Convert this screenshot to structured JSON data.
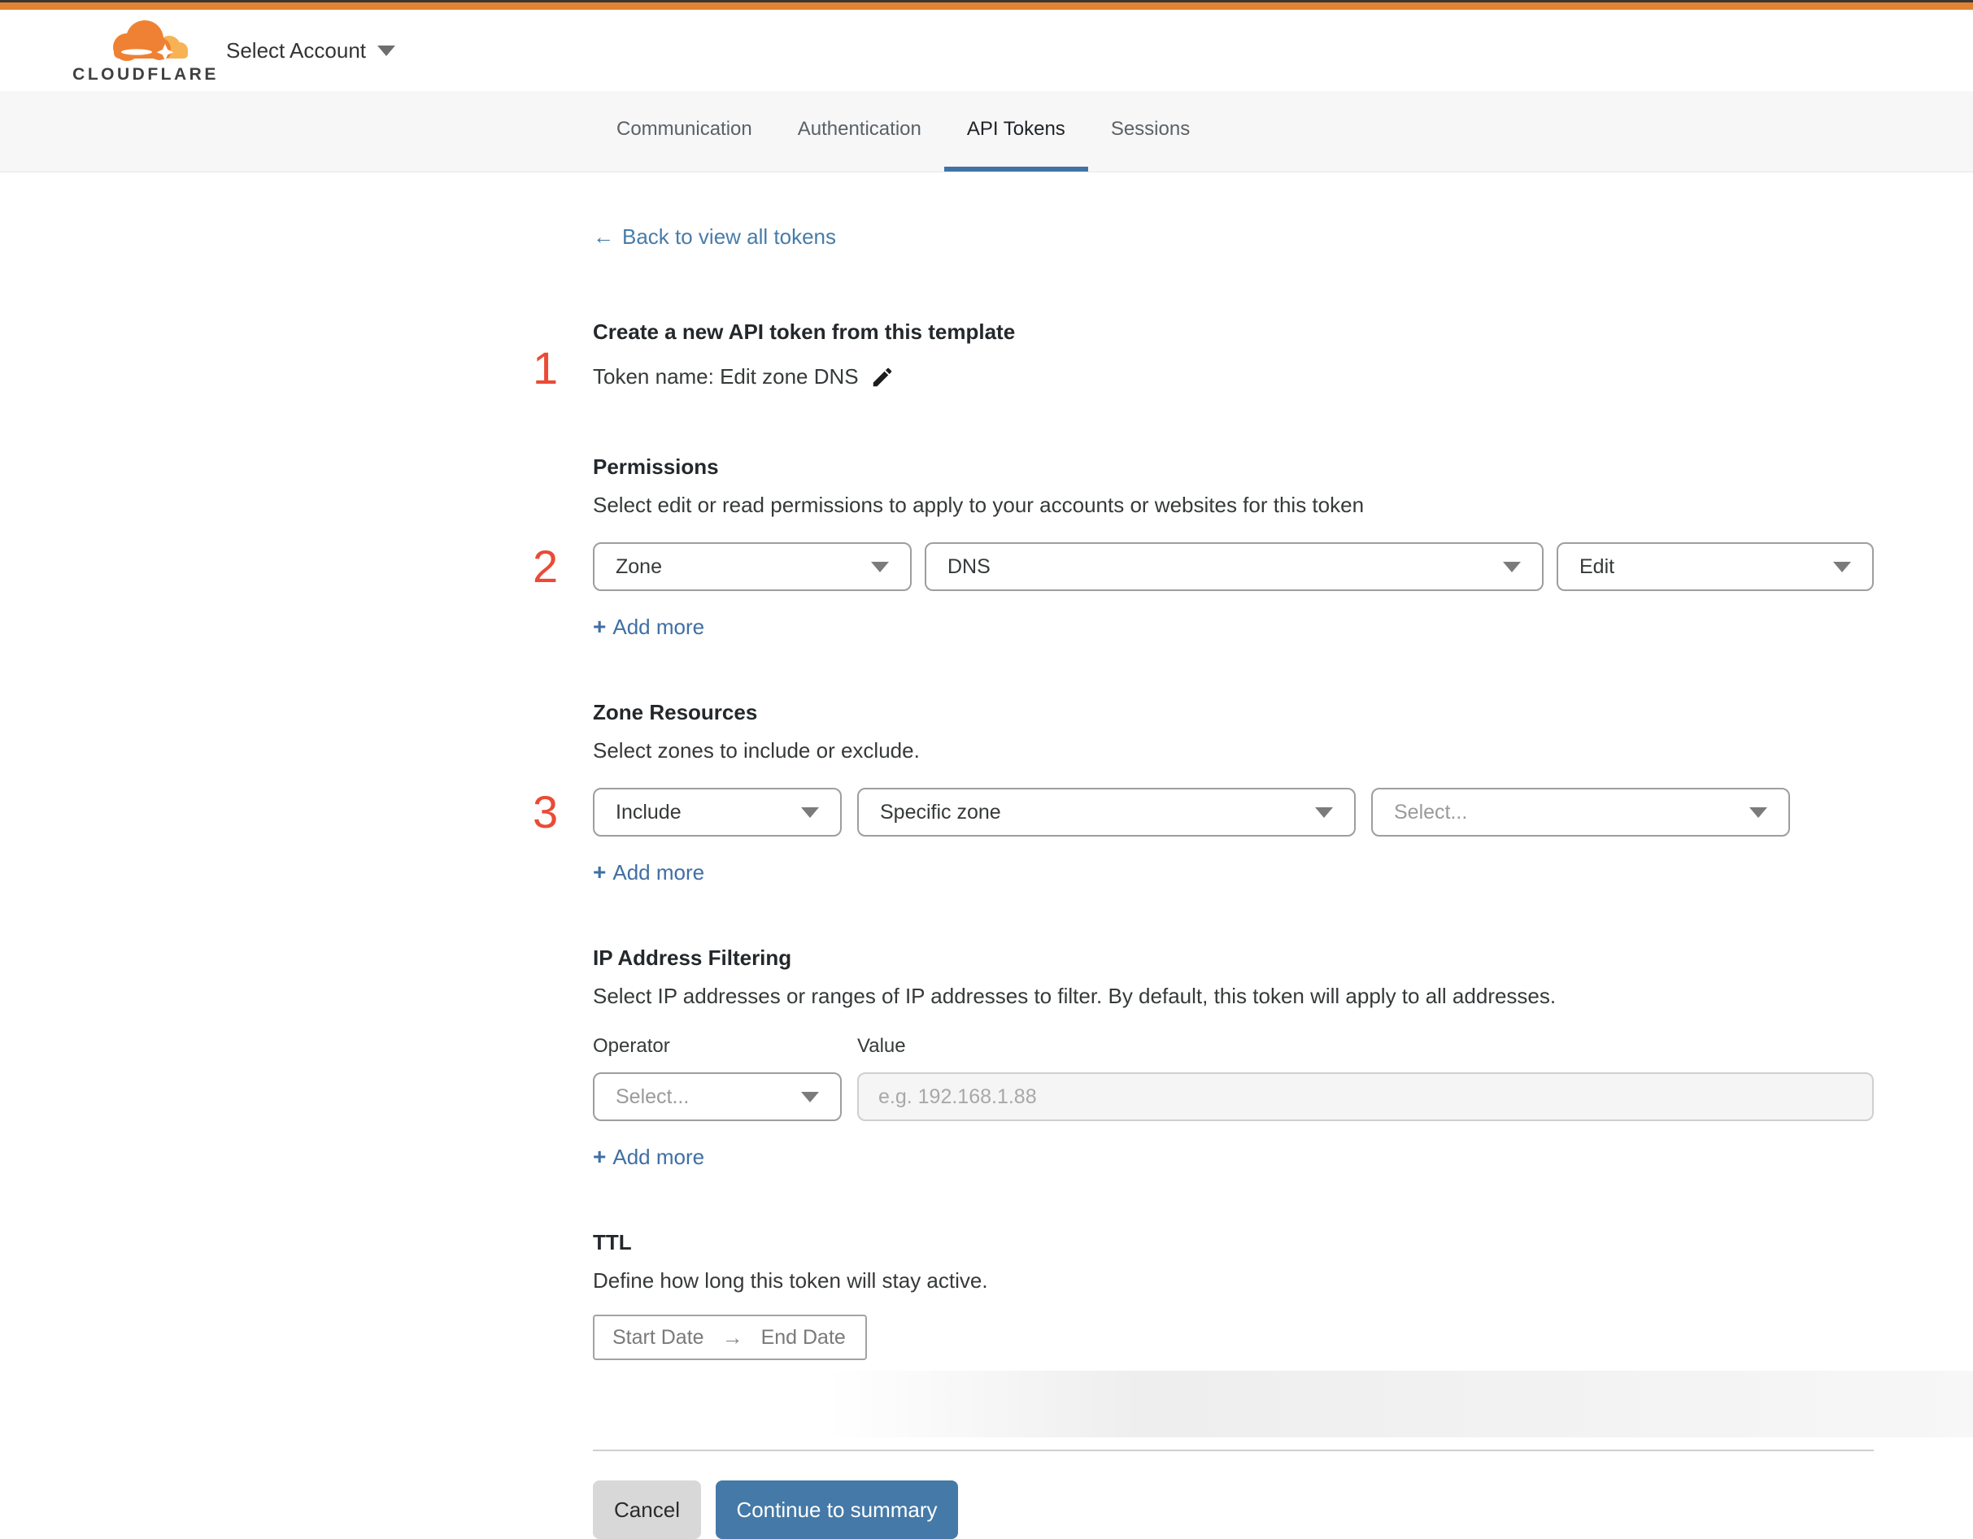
{
  "header": {
    "brand": "CLOUDFLARE",
    "account_selector": "Select Account"
  },
  "tabs": [
    {
      "label": "Communication",
      "active": false
    },
    {
      "label": "Authentication",
      "active": false
    },
    {
      "label": "API Tokens",
      "active": true
    },
    {
      "label": "Sessions",
      "active": false
    }
  ],
  "back_link": {
    "arrow": "←",
    "label": "Back to view all tokens"
  },
  "steps": {
    "one": "1",
    "two": "2",
    "three": "3"
  },
  "token": {
    "heading": "Create a new API token from this template",
    "name_line": "Token name: Edit zone DNS"
  },
  "permissions": {
    "heading": "Permissions",
    "description": "Select edit or read permissions to apply to your accounts or websites for this token",
    "scope_value": "Zone",
    "resource_value": "DNS",
    "access_value": "Edit",
    "add_more_plus": "+",
    "add_more_label": "Add more"
  },
  "zone_resources": {
    "heading": "Zone Resources",
    "description": "Select zones to include or exclude.",
    "mode_value": "Include",
    "type_value": "Specific zone",
    "zone_placeholder": "Select...",
    "add_more_plus": "+",
    "add_more_label": "Add more"
  },
  "ip_filtering": {
    "heading": "IP Address Filtering",
    "description": "Select IP addresses or ranges of IP addresses to filter. By default, this token will apply to all addresses.",
    "operator_label": "Operator",
    "value_label": "Value",
    "operator_placeholder": "Select...",
    "value_placeholder": "e.g. 192.168.1.88",
    "add_more_plus": "+",
    "add_more_label": "Add more"
  },
  "ttl": {
    "heading": "TTL",
    "description": "Define how long this token will stay active.",
    "start_label": "Start Date",
    "arrow": "→",
    "end_label": "End Date"
  },
  "footer": {
    "cancel_label": "Cancel",
    "continue_label": "Continue to summary"
  },
  "colors": {
    "top_bar_orange": "#e08434",
    "brand_cloud_orange": "#ee8133",
    "brand_cloud_light": "#f6b253",
    "link_blue": "#477ca8",
    "button_blue": "#4479a8",
    "tab_underline_blue": "#4173a6",
    "step_number_red": "#ea4b35"
  }
}
